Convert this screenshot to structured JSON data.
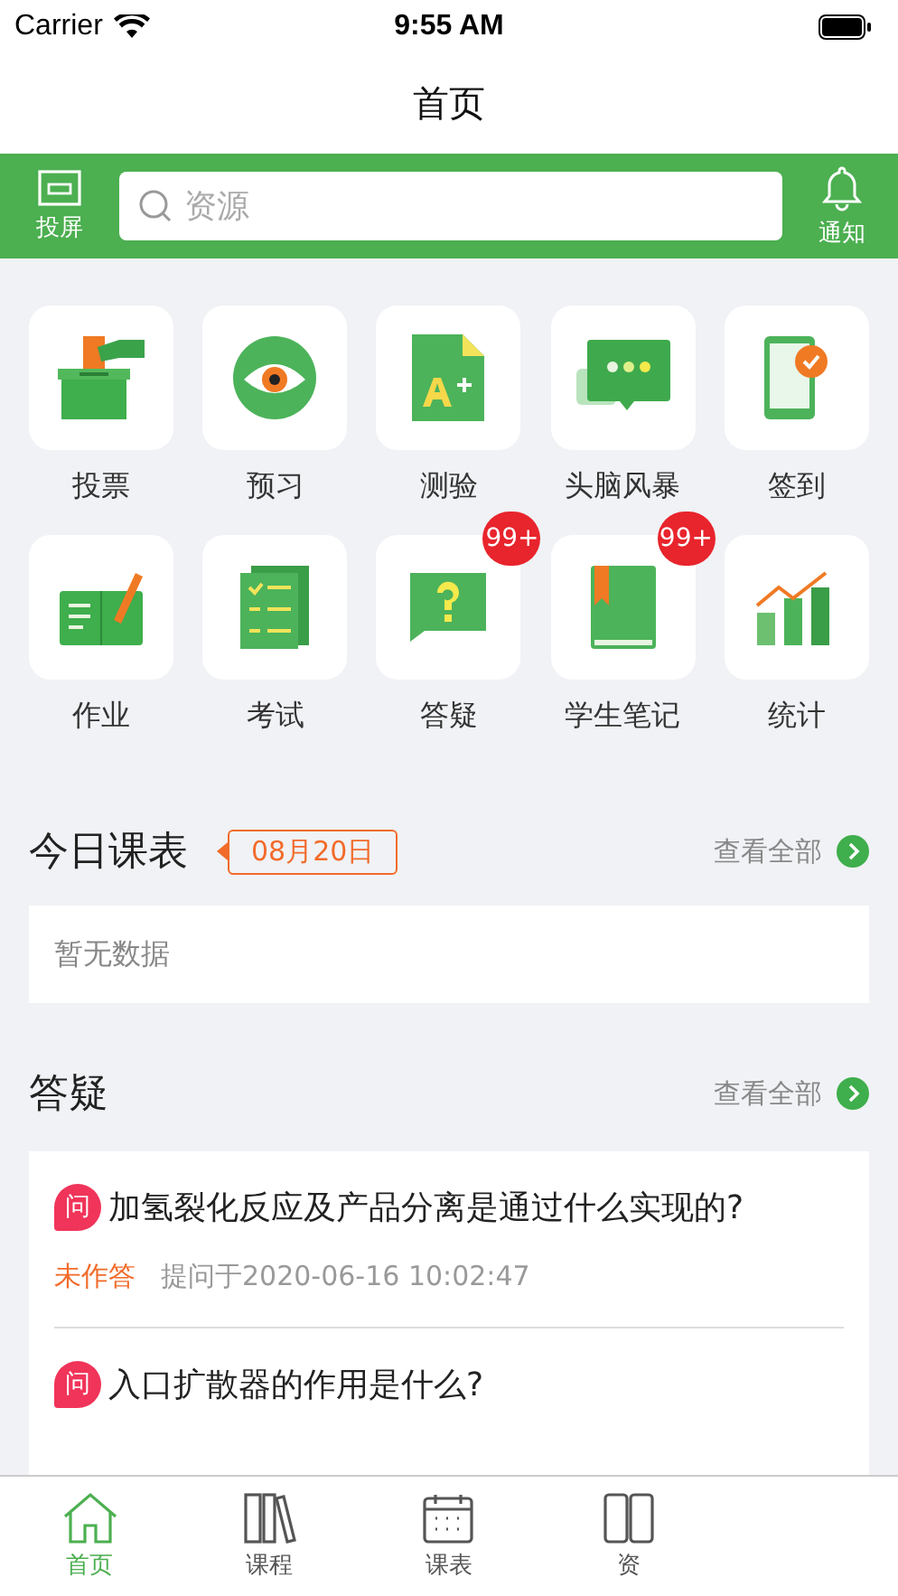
{
  "status_bar": {
    "carrier": "Carrier",
    "time": "9:55 AM"
  },
  "title": "首页",
  "toolbar": {
    "cast_label": "投屏",
    "search": {
      "placeholder": "资源"
    },
    "notify_label": "通知"
  },
  "features": [
    {
      "label": "投票"
    },
    {
      "label": "预习"
    },
    {
      "label": "测验"
    },
    {
      "label": "头脑风暴"
    },
    {
      "label": "签到"
    },
    {
      "label": "作业"
    },
    {
      "label": "考试"
    },
    {
      "label": "答疑",
      "badge": "99+"
    },
    {
      "label": "学生笔记",
      "badge": "99+"
    },
    {
      "label": "统计"
    }
  ],
  "schedule": {
    "title": "今日课表",
    "date": "08月20日",
    "more": "查看全部",
    "empty": "暂无数据"
  },
  "qa": {
    "title": "答疑",
    "more": "查看全部",
    "questions": [
      {
        "mark": "问",
        "text": "加氢裂化反应及产品分离是通过什么实现的?",
        "status": "未作答",
        "asked": "提问于2020-06-16 10:02:47"
      },
      {
        "mark": "问",
        "text": "入口扩散器的作用是什么?"
      }
    ]
  },
  "tab_bar": [
    {
      "label": "首页",
      "selected": true
    },
    {
      "label": "课程",
      "selected": false
    },
    {
      "label": "课表",
      "selected": false
    },
    {
      "label": "资",
      "selected": false
    }
  ]
}
